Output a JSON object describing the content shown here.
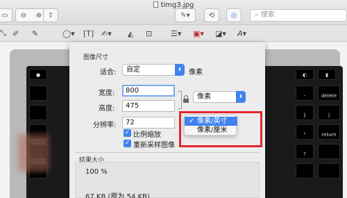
{
  "window": {
    "filename": "timg3.jpg",
    "search_placeholder": "搜索"
  },
  "dialog": {
    "section_image_size": "图像尺寸",
    "fit_label": "适合:",
    "fit_value": "自定",
    "fit_unit": "像素",
    "width_label": "宽度:",
    "width_value": "800",
    "height_label": "高度:",
    "height_value": "475",
    "size_unit_value": "像素",
    "resolution_label": "分辨率:",
    "resolution_value": "72",
    "checkbox_scale": "比例缩放",
    "checkbox_resample": "重新采样图像",
    "section_result": "结果大小",
    "result_percent": "100 %",
    "result_size": "67 KB (原为 54 KB)"
  },
  "resolution_menu": {
    "items": [
      "像素/英寸",
      "像素/厘米"
    ],
    "selected_index": 0
  },
  "colors": {
    "accent": "#3f82f0",
    "highlight": "#e3262b"
  },
  "keyboard_keys": [
    "delete",
    "return"
  ]
}
